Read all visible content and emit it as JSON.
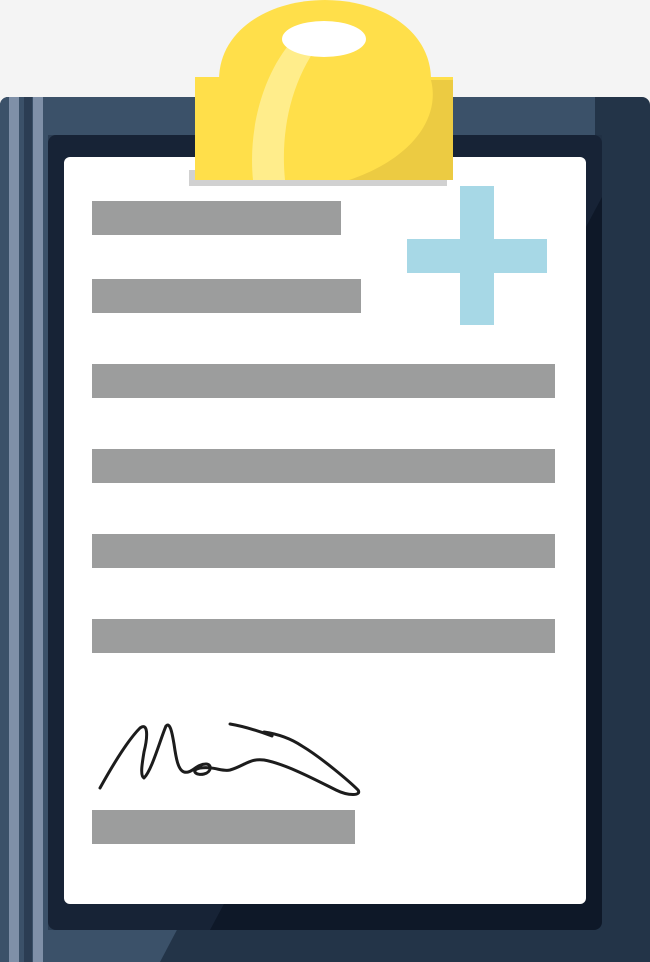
{
  "colors": {
    "background": "#f4f4f4",
    "board_main": "#233448",
    "board_light": "#3b5169",
    "board_stripe": "#7f90a8",
    "board_inner": "#0e1828",
    "paper": "#ffffff",
    "text_line": "#9c9d9d",
    "cross": "#a7d8e6",
    "clip_yellow": "#ffdf4a",
    "clip_shade": "#eccb42",
    "clip_highlight": "#fff096",
    "signature_ink": "#1c1c1c"
  },
  "icons": {
    "clip": "clipboard-clip-icon",
    "cross": "medical-cross-icon",
    "signature": "handwritten-signature"
  },
  "document": {
    "line_count": 7
  }
}
